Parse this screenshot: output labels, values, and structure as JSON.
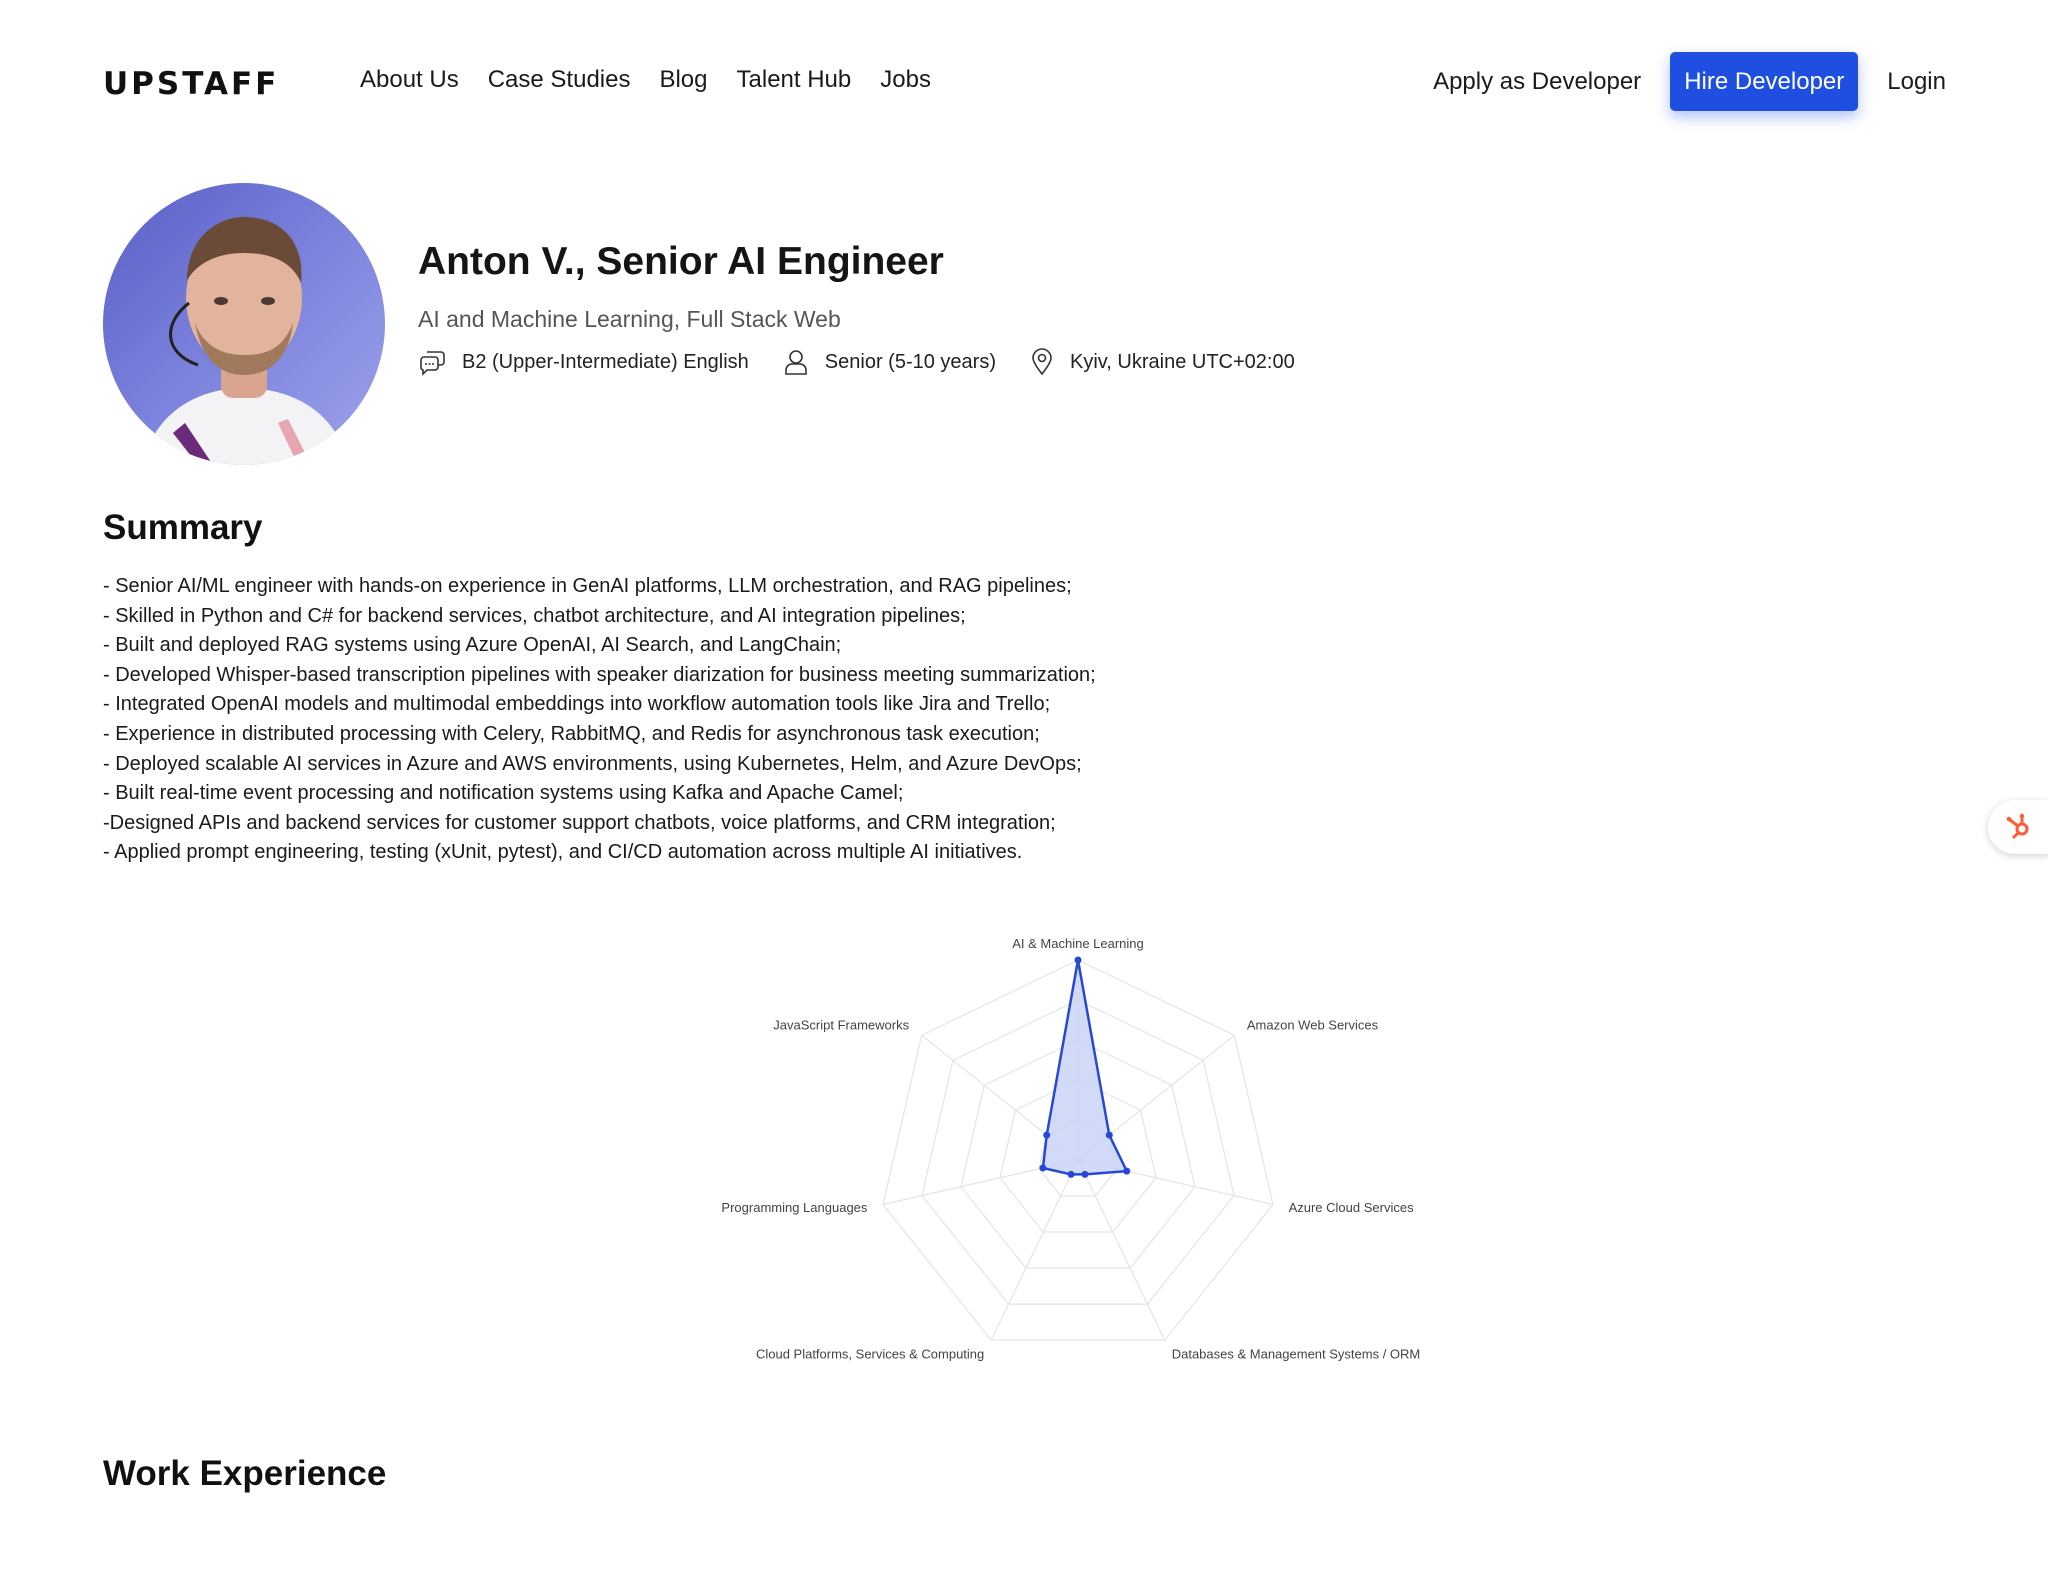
{
  "header": {
    "logo": "UPSTAFF",
    "nav": [
      "About Us",
      "Case Studies",
      "Blog",
      "Talent Hub",
      "Jobs"
    ],
    "apply_label": "Apply as Developer",
    "hire_label": "Hire Developer",
    "login_label": "Login"
  },
  "profile": {
    "name": "Anton V., Senior AI Engineer",
    "subtitle": "AI and Machine Learning, Full Stack Web",
    "language": "B2 (Upper-Intermediate) English",
    "seniority": "Senior (5-10 years)",
    "location": "Kyiv, Ukraine UTC+02:00"
  },
  "summary": {
    "title": "Summary",
    "lines": [
      "- Senior AI/ML engineer with hands-on experience in GenAI platforms, LLM orchestration, and RAG pipelines;",
      "- Skilled in Python and C# for backend services, chatbot architecture, and AI integration pipelines;",
      "- Built and deployed RAG systems using Azure OpenAI, AI Search, and LangChain;",
      "- Developed Whisper-based transcription pipelines with speaker diarization for business meeting summarization;",
      "- Integrated OpenAI models and multimodal embeddings into workflow automation tools like Jira and Trello;",
      "- Experience in distributed processing with Celery, RabbitMQ, and Redis for asynchronous task execution;",
      "- Deployed scalable AI services in Azure and AWS environments, using Kubernetes, Helm, and Azure DevOps;",
      "- Built real-time event processing and notification systems using Kafka and Apache Camel;",
      "-Designed APIs and backend services for customer support chatbots, voice platforms, and CRM integration;",
      "- Applied prompt engineering, testing (xUnit, pytest), and CI/CD automation across multiple AI initiatives."
    ]
  },
  "chart_data": {
    "type": "radar",
    "categories": [
      "AI & Machine Learning",
      "Amazon Web Services",
      "Azure Cloud Services",
      "Databases & Management Systems / ORM",
      "Cloud Platforms, Services & Computing",
      "Programming Languages",
      "JavaScript Frameworks"
    ],
    "values": [
      100,
      20,
      25,
      8,
      8,
      18,
      20
    ],
    "ylim": [
      0,
      100
    ],
    "rings": 5,
    "grid": true,
    "color": "#2748d6",
    "fill": "#c9d3f5"
  },
  "work_experience": {
    "title": "Work Experience"
  },
  "colors": {
    "accent": "#1f4fe0",
    "hubspot": "#ff5c35"
  }
}
